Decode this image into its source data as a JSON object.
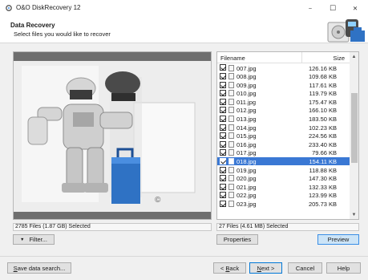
{
  "window": {
    "title": "O&O DiskRecovery 12",
    "minimize": "−",
    "maximize": "☐",
    "close": "✕"
  },
  "header": {
    "title": "Data Recovery",
    "subtitle": "Select files you would like to recover"
  },
  "file_list": {
    "columns": {
      "filename": "Filename",
      "size": "Size"
    },
    "rows": [
      {
        "name": "007.jpg",
        "size": "126.16 KB",
        "checked": true,
        "selected": false
      },
      {
        "name": "008.jpg",
        "size": "109.68 KB",
        "checked": true,
        "selected": false
      },
      {
        "name": "009.jpg",
        "size": "117.61 KB",
        "checked": true,
        "selected": false
      },
      {
        "name": "010.jpg",
        "size": "119.79 KB",
        "checked": true,
        "selected": false
      },
      {
        "name": "011.jpg",
        "size": "175.47 KB",
        "checked": true,
        "selected": false
      },
      {
        "name": "012.jpg",
        "size": "166.10 KB",
        "checked": true,
        "selected": false
      },
      {
        "name": "013.jpg",
        "size": "183.50 KB",
        "checked": true,
        "selected": false
      },
      {
        "name": "014.jpg",
        "size": "102.23 KB",
        "checked": true,
        "selected": false
      },
      {
        "name": "015.jpg",
        "size": "224.56 KB",
        "checked": true,
        "selected": false
      },
      {
        "name": "016.jpg",
        "size": "233.40 KB",
        "checked": true,
        "selected": false
      },
      {
        "name": "017.jpg",
        "size": "79.66 KB",
        "checked": true,
        "selected": false
      },
      {
        "name": "018.jpg",
        "size": "154.11 KB",
        "checked": true,
        "selected": true
      },
      {
        "name": "019.jpg",
        "size": "118.88 KB",
        "checked": true,
        "selected": false
      },
      {
        "name": "020.jpg",
        "size": "147.30 KB",
        "checked": true,
        "selected": false
      },
      {
        "name": "021.jpg",
        "size": "132.33 KB",
        "checked": true,
        "selected": false
      },
      {
        "name": "022.jpg",
        "size": "123.99 KB",
        "checked": true,
        "selected": false
      },
      {
        "name": "023.jpg",
        "size": "205.73 KB",
        "checked": true,
        "selected": false
      }
    ]
  },
  "status": {
    "left": "2785 Files (1.87 GB) Selected",
    "right": "27 Files (4.61 MB) Selected"
  },
  "buttons": {
    "filter": "Filter...",
    "properties": "Properties",
    "preview": "Preview",
    "save_search_prefix": "S",
    "save_search_rest": "ave data search...",
    "back_prefix": "< ",
    "back_ul": "B",
    "back_rest": "ack",
    "next_ul": "N",
    "next_rest": "ext >",
    "cancel": "Cancel",
    "help": "Help"
  },
  "colors": {
    "selection": "#3a78d4",
    "preview_button": "#cce4f7"
  }
}
